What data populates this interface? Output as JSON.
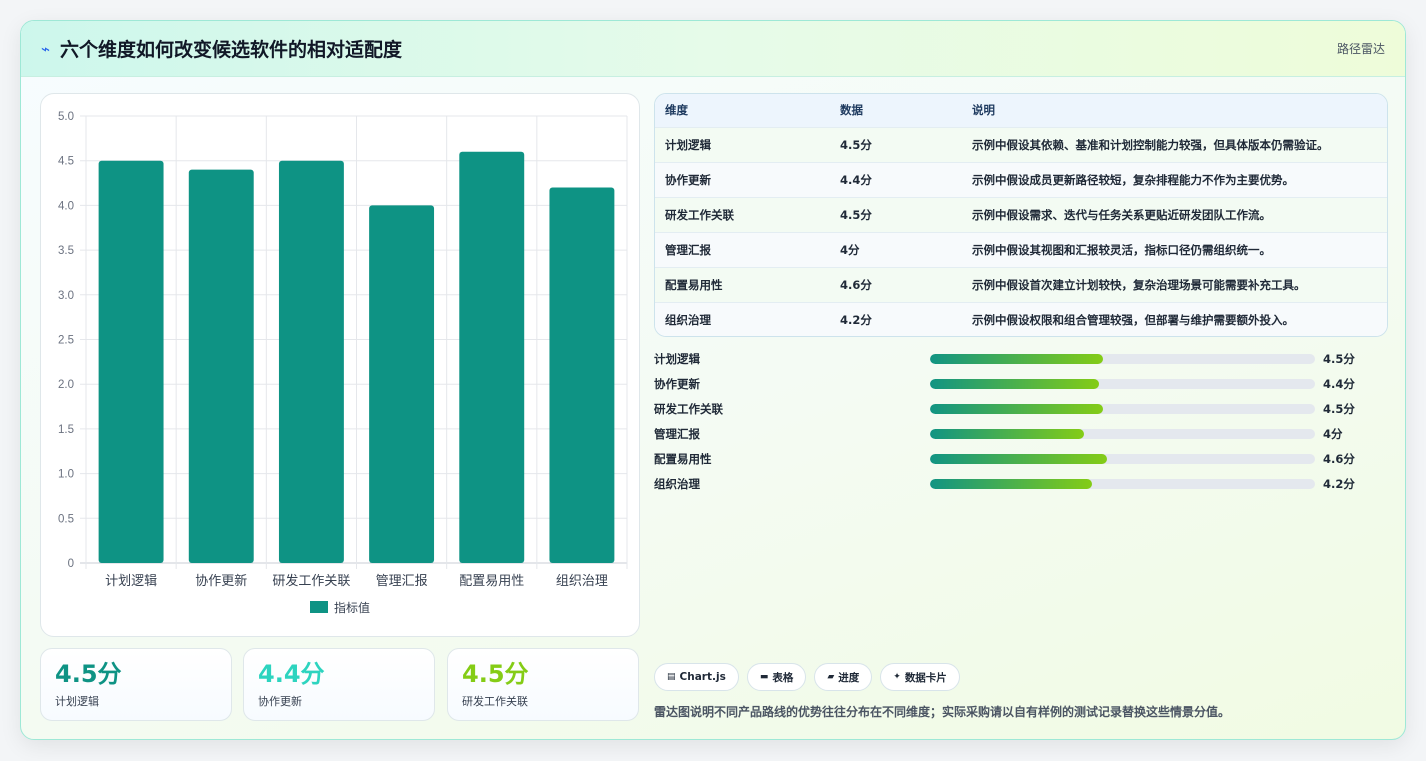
{
  "header": {
    "icon": "bolt-icon",
    "title": "六个维度如何改变候选软件的相对适配度",
    "tag": "路径雷达"
  },
  "chart_data": {
    "type": "bar",
    "categories": [
      "计划逻辑",
      "协作更新",
      "研发工作关联",
      "管理汇报",
      "配置易用性",
      "组织治理"
    ],
    "series": [
      {
        "name": "指标值",
        "values": [
          4.5,
          4.4,
          4.5,
          4.0,
          4.6,
          4.2
        ],
        "color": "#0e9384"
      }
    ],
    "ylim": [
      0,
      5
    ],
    "yticks": [
      "0",
      "0.5",
      "1.0",
      "1.5",
      "2.0",
      "2.5",
      "3.0",
      "3.5",
      "4.0",
      "4.5",
      "5.0"
    ],
    "grid": true,
    "legend": "bottom"
  },
  "metrics": [
    {
      "value": "4.5分",
      "label": "计划逻辑",
      "color": "#0e9384"
    },
    {
      "value": "4.4分",
      "label": "协作更新",
      "color": "#2dd4bf"
    },
    {
      "value": "4.5分",
      "label": "研发工作关联",
      "color": "#84cc16"
    }
  ],
  "table": {
    "headers": [
      "维度",
      "数据",
      "说明"
    ],
    "rows": [
      {
        "dim": "计划逻辑",
        "val": "4.5分",
        "desc": "示例中假设其依赖、基准和计划控制能力较强，但具体版本仍需验证。"
      },
      {
        "dim": "协作更新",
        "val": "4.4分",
        "desc": "示例中假设成员更新路径较短，复杂排程能力不作为主要优势。"
      },
      {
        "dim": "研发工作关联",
        "val": "4.5分",
        "desc": "示例中假设需求、迭代与任务关系更贴近研发团队工作流。"
      },
      {
        "dim": "管理汇报",
        "val": "4分",
        "desc": "示例中假设其视图和汇报较灵活，指标口径仍需组织统一。"
      },
      {
        "dim": "配置易用性",
        "val": "4.6分",
        "desc": "示例中假设首次建立计划较快，复杂治理场景可能需要补充工具。"
      },
      {
        "dim": "组织治理",
        "val": "4.2分",
        "desc": "示例中假设权限和组合管理较强，但部署与维护需要额外投入。"
      }
    ]
  },
  "progress": [
    {
      "label": "计划逻辑",
      "score": "4.5分",
      "value": 4.5
    },
    {
      "label": "协作更新",
      "score": "4.4分",
      "value": 4.4
    },
    {
      "label": "研发工作关联",
      "score": "4.5分",
      "value": 4.5
    },
    {
      "label": "管理汇报",
      "score": "4分",
      "value": 4.0
    },
    {
      "label": "配置易用性",
      "score": "4.6分",
      "value": 4.6
    },
    {
      "label": "组织治理",
      "score": "4.2分",
      "value": 4.2
    }
  ],
  "progress_max": 10,
  "chips": [
    {
      "icon": "chart-icon",
      "glyph": "▤",
      "label": "Chart.js"
    },
    {
      "icon": "table-icon",
      "glyph": "▬",
      "label": "表格"
    },
    {
      "icon": "progress-icon",
      "glyph": "▰",
      "label": "进度"
    },
    {
      "icon": "sparkle-icon",
      "glyph": "✦",
      "label": "数据卡片"
    }
  ],
  "note": "雷达图说明不同产品路线的优势往往分布在不同维度；实际采购请以自有样例的测试记录替换这些情景分值。"
}
